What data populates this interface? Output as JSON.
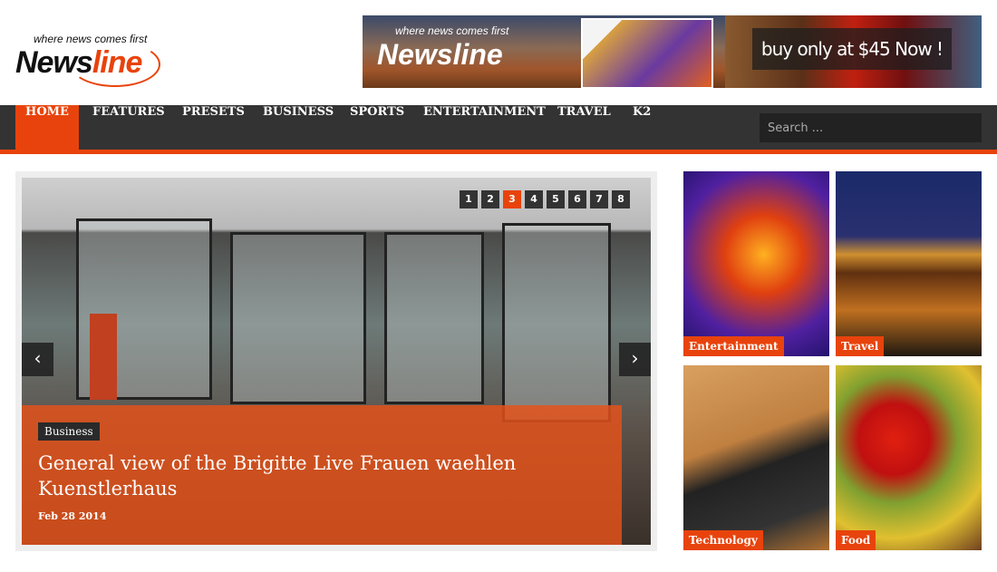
{
  "logo": {
    "tagline": "where news comes first",
    "name_part1": "News",
    "name_part2": "line"
  },
  "banner": {
    "tagline": "where news comes first",
    "name": "Newsline",
    "cta": "buy only at $45 Now !"
  },
  "nav": {
    "items": [
      "HOME",
      "FEATURES",
      "PRESETS",
      "BUSINESS",
      "SPORTS",
      "ENTERTAINMENT",
      "TRAVEL",
      "K2"
    ],
    "active": "HOME",
    "search_placeholder": "Search ..."
  },
  "slider": {
    "pages": [
      "1",
      "2",
      "3",
      "4",
      "5",
      "6",
      "7",
      "8"
    ],
    "current_page": "3",
    "prev_icon": "chevron-left",
    "next_icon": "chevron-right",
    "category": "Business",
    "title": "General view of the Brigitte Live Frauen waehlen Kuenstlerhaus",
    "date": "Feb 28 2014"
  },
  "tiles": [
    {
      "label": "Entertainment"
    },
    {
      "label": "Travel"
    },
    {
      "label": "Technology"
    },
    {
      "label": "Food"
    }
  ],
  "colors": {
    "accent": "#e8430c",
    "nav_bg": "#333333"
  }
}
